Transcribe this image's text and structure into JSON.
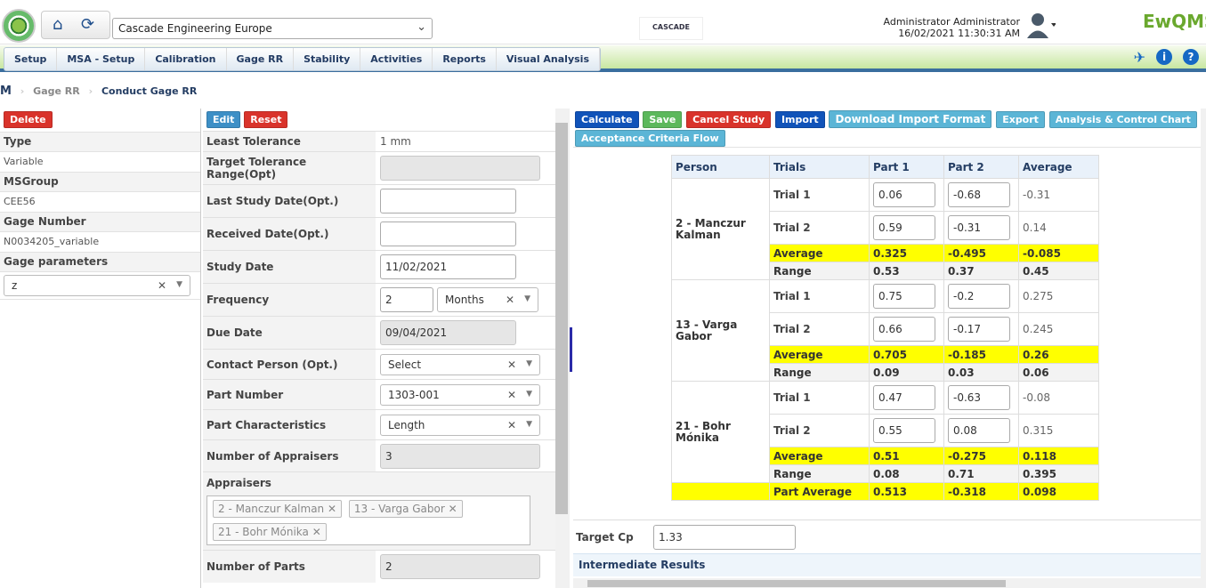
{
  "header": {
    "company": "Cascade Engineering Europe",
    "brand": "CASCADE",
    "user_name": "Administrator Administrator",
    "datetime": "16/02/2021 11:30:31 AM",
    "product": "EwQMS"
  },
  "menu": [
    "Setup",
    "MSA - Setup",
    "Calibration",
    "Gage RR",
    "Stability",
    "Activities",
    "Reports",
    "Visual Analysis"
  ],
  "breadcrumb": {
    "root": "Gage RR",
    "current": "Conduct Gage RR"
  },
  "left": {
    "delete": "Delete",
    "type_label": "Type",
    "type_value": "Variable",
    "msgroup_label": "MSGroup",
    "msgroup_value": "CEE56",
    "gage_label": "Gage Number",
    "gage_value": "N0034205_variable",
    "params_label": "Gage parameters",
    "params_value": "z"
  },
  "mid": {
    "edit": "Edit",
    "reset": "Reset",
    "least_tol_label": "Least Tolerance",
    "least_tol_value": "1 mm",
    "target_tol_label": "Target Tolerance Range(Opt)",
    "last_study_label": "Last Study Date(Opt.)",
    "received_label": "Received Date(Opt.)",
    "study_date_label": "Study Date",
    "study_date_value": "11/02/2021",
    "frequency_label": "Frequency",
    "frequency_value": "2",
    "frequency_unit": "Months",
    "due_label": "Due Date",
    "due_value": "09/04/2021",
    "contact_label": "Contact Person (Opt.)",
    "contact_value": "Select",
    "part_num_label": "Part Number",
    "part_num_value": "1303-001",
    "part_char_label": "Part Characteristics",
    "part_char_value": "Length",
    "num_app_label": "Number of Appraisers",
    "num_app_value": "3",
    "appraisers_label": "Appraisers",
    "appraisers": [
      "2 - Manczur Kalman",
      "13 - Varga Gabor",
      "21 - Bohr Mónika"
    ],
    "num_parts_label": "Number of Parts",
    "num_parts_value": "2"
  },
  "right": {
    "buttons": {
      "calculate": "Calculate",
      "save": "Save",
      "cancel": "Cancel Study",
      "import": "Import",
      "download": "Download Import Format",
      "export": "Export",
      "analysis": "Analysis & Control Chart",
      "acceptance": "Acceptance Criteria Flow"
    },
    "headers": [
      "Person",
      "Trials",
      "Part 1",
      "Part 2",
      "Average"
    ],
    "groups": [
      {
        "person": "2 - Manczur Kalman",
        "trials": [
          {
            "label": "Trial 1",
            "p1": "0.06",
            "p2": "-0.68",
            "avg": "-0.31"
          },
          {
            "label": "Trial 2",
            "p1": "0.59",
            "p2": "-0.31",
            "avg": "0.14"
          }
        ],
        "average": {
          "label": "Average",
          "p1": "0.325",
          "p2": "-0.495",
          "avg": "-0.085"
        },
        "range": {
          "label": "Range",
          "p1": "0.53",
          "p2": "0.37",
          "avg": "0.45"
        }
      },
      {
        "person": "13 - Varga Gabor",
        "trials": [
          {
            "label": "Trial 1",
            "p1": "0.75",
            "p2": "-0.2",
            "avg": "0.275"
          },
          {
            "label": "Trial 2",
            "p1": "0.66",
            "p2": "-0.17",
            "avg": "0.245"
          }
        ],
        "average": {
          "label": "Average",
          "p1": "0.705",
          "p2": "-0.185",
          "avg": "0.26"
        },
        "range": {
          "label": "Range",
          "p1": "0.09",
          "p2": "0.03",
          "avg": "0.06"
        }
      },
      {
        "person": "21 - Bohr Mónika",
        "trials": [
          {
            "label": "Trial 1",
            "p1": "0.47",
            "p2": "-0.63",
            "avg": "-0.08"
          },
          {
            "label": "Trial 2",
            "p1": "0.55",
            "p2": "0.08",
            "avg": "0.315"
          }
        ],
        "average": {
          "label": "Average",
          "p1": "0.51",
          "p2": "-0.275",
          "avg": "0.118"
        },
        "range": {
          "label": "Range",
          "p1": "0.08",
          "p2": "0.71",
          "avg": "0.395"
        }
      }
    ],
    "part_average": {
      "label": "Part Average",
      "p1": "0.513",
      "p2": "-0.318",
      "avg": "0.098"
    },
    "target_cp_label": "Target Cp",
    "target_cp_value": "1.33",
    "intermediate": "Intermediate Results"
  }
}
